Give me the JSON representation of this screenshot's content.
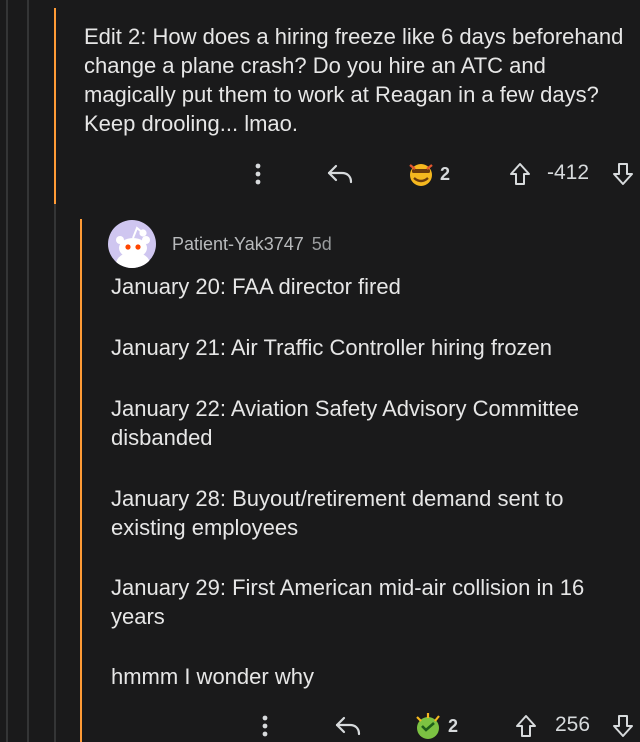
{
  "parent_comment": {
    "text": "Edit 2: How does a hiring freeze like 6 days beforehand change a plane crash? Do you hire an ATC and magically put them to work at Reagan in a few days? Keep drooling... lmao.",
    "award_count": "2",
    "vote_score": "-412",
    "icons": [
      "more-icon",
      "reply-icon",
      "award-icon",
      "upvote-icon",
      "downvote-icon"
    ]
  },
  "reply_comment": {
    "username": "Patient-Yak3747",
    "age": "5d",
    "lines": [
      "January 20: FAA director fired",
      "January 21: Air Traffic Controller hiring frozen",
      "January 22: Aviation Safety Advisory Committee disbanded",
      "January 28: Buyout/retirement demand sent to existing employees",
      "January 29: First American mid-air collision in 16 years",
      "hmmm I wonder why"
    ],
    "award_count": "2",
    "vote_score": "256"
  },
  "colors": {
    "background": "#1a1a1b",
    "text": "#d7dadc",
    "thread_line_highlight": "#ff9b36",
    "thread_line": "#343536"
  }
}
